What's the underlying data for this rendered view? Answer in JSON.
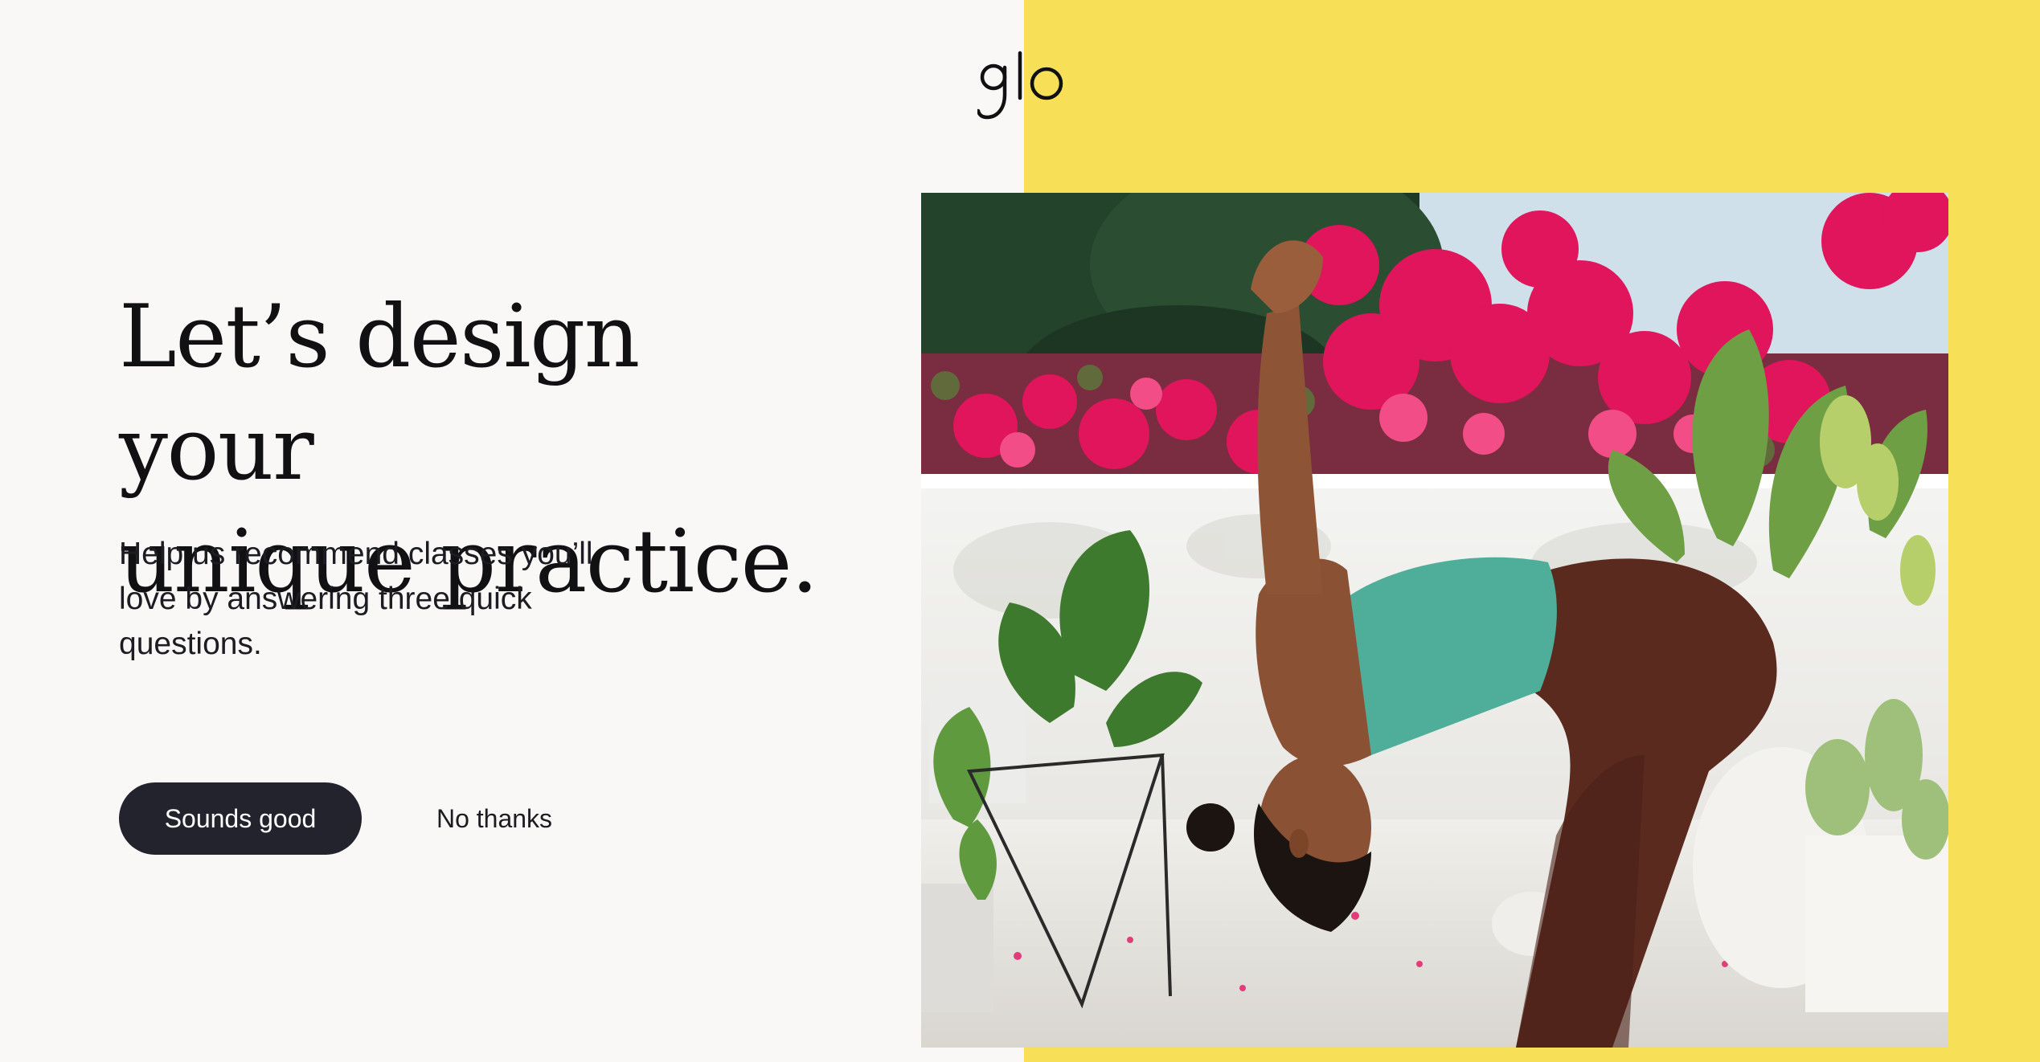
{
  "brand": {
    "logo_text": "glo",
    "accent_color": "#f7e058",
    "background_color": "#f9f8f6"
  },
  "hero": {
    "headline_line1": "Let’s design your",
    "headline_line2": "unique practice.",
    "subtitle_line1": "Help us recommend classes you’ll",
    "subtitle_line2": "love by answering three quick",
    "subtitle_line3": "questions."
  },
  "actions": {
    "primary_label": "Sounds good",
    "primary_color": "#22232d",
    "secondary_label": "No thanks"
  }
}
